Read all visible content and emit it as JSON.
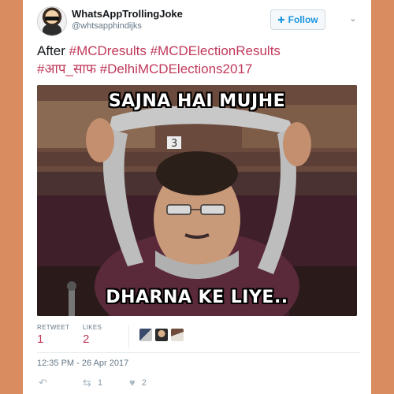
{
  "tweet": {
    "author": {
      "name": "WhatsAppTrollingJoke",
      "handle": "@whtsapphindijks"
    },
    "follow_label": "Follow",
    "text": {
      "prefix": "After ",
      "hashtags_line1": "#MCDresults #MCDElectionResults",
      "hashtags_line2": "#आप_साफ #DelhiMCDElections2017"
    },
    "media": {
      "top_caption": "SAJNA HAI MUJHE",
      "bottom_caption": "DHARNA KE LIYE.."
    },
    "stats": {
      "retweets_label": "RETWEET",
      "retweets_count": "1",
      "likes_label": "LIKES",
      "likes_count": "2"
    },
    "timestamp": "12:35 PM - 26 Apr 2017",
    "actions": {
      "retweet_count": "1",
      "like_count": "2"
    },
    "colors": {
      "accent": "#c1395a",
      "follow_blue": "#1b95e0",
      "background": "#d98c5f"
    }
  }
}
